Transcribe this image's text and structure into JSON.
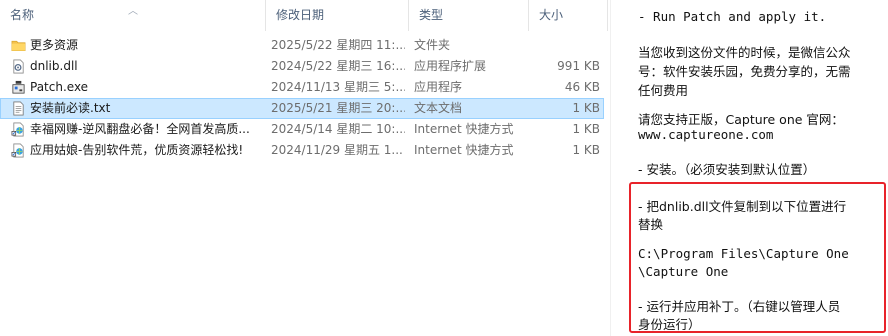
{
  "columns": {
    "name": "名称",
    "date": "修改日期",
    "type": "类型",
    "size": "大小"
  },
  "files": [
    {
      "name": "更多资源",
      "date": "2025/5/22 星期四 11:...",
      "type": "文件夹",
      "size": "",
      "icon": "folder-icon"
    },
    {
      "name": "dnlib.dll",
      "date": "2024/5/22 星期三 16:...",
      "type": "应用程序扩展",
      "size": "991 KB",
      "icon": "dll-file-icon"
    },
    {
      "name": "Patch.exe",
      "date": "2024/11/13 星期三 5:...",
      "type": "应用程序",
      "size": "46 KB",
      "icon": "exe-file-icon"
    },
    {
      "name": "安装前必读.txt",
      "date": "2025/5/21 星期三 20:...",
      "type": "文本文档",
      "size": "1 KB",
      "icon": "text-file-icon",
      "selected": true
    },
    {
      "name": "幸福网赚-逆风翻盘必备！全网首发高质...",
      "date": "2024/5/14 星期二 10:...",
      "type": "Internet 快捷方式",
      "size": "1 KB",
      "icon": "internet-shortcut-icon"
    },
    {
      "name": "应用姑娘-告别软件荒，优质资源轻松找!",
      "date": "2024/11/29 星期五 1...",
      "type": "Internet 快捷方式",
      "size": "1 KB",
      "icon": "internet-shortcut-icon"
    }
  ],
  "viewer": {
    "lines": [
      "- Run Patch and apply it.",
      "当您收到这份文件的时候，是微信公众",
      "号：软件安装乐园，免费分享的，无需",
      "任何费用",
      "请您支持正版，Capture  one 官网：",
      "www.captureone.com",
      "- 安装。（必须安装到默认位置）",
      "- 把dnlib.dll文件复制到以下位置进行",
      "替换",
      "C:\\Program Files\\Capture One",
      "\\Capture One",
      "- 运行并应用补丁。（右键以管理人员",
      "身份运行）"
    ]
  },
  "colors": {
    "selection": "#cce8ff",
    "highlight": "#e8232a",
    "folder": "#f4c24e"
  }
}
